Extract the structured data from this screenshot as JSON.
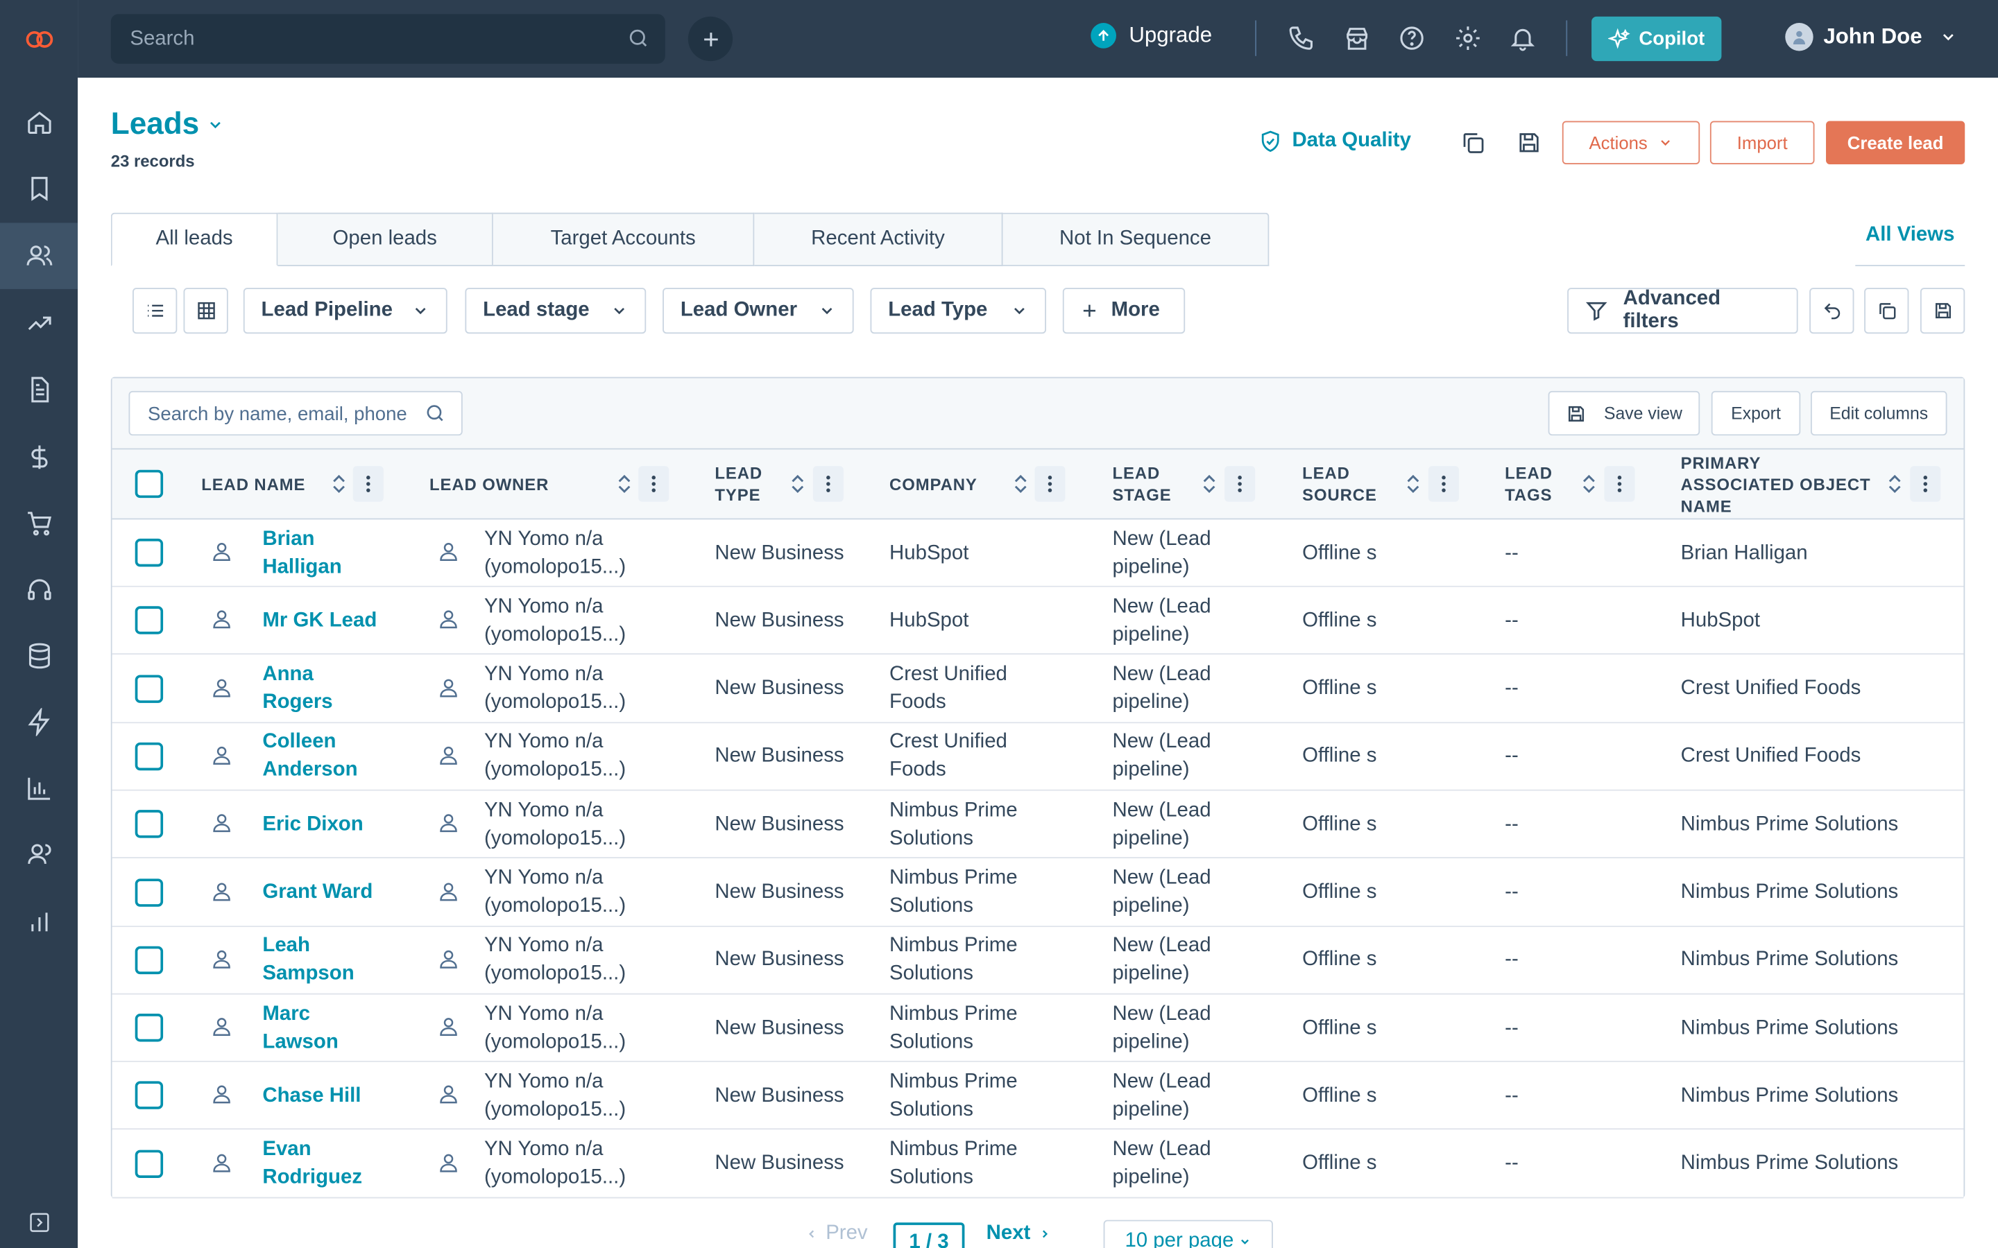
{
  "topbar": {
    "search_placeholder": "Search",
    "upgrade_label": "Upgrade",
    "copilot_label": "Copilot",
    "user_name": "John Doe"
  },
  "sidebar": {
    "items": [
      {
        "icon": "home-icon"
      },
      {
        "icon": "bookmark-icon"
      },
      {
        "icon": "contacts-icon",
        "active": true
      },
      {
        "icon": "trend-icon"
      },
      {
        "icon": "document-icon"
      },
      {
        "icon": "dollar-icon"
      },
      {
        "icon": "cart-icon"
      },
      {
        "icon": "headset-icon"
      },
      {
        "icon": "database-icon"
      },
      {
        "icon": "lightning-icon"
      },
      {
        "icon": "bar-chart-icon"
      },
      {
        "icon": "people-icon"
      },
      {
        "icon": "analytics-icon"
      }
    ]
  },
  "header": {
    "title": "Leads",
    "records": "23 records",
    "data_quality": "Data Quality",
    "actions_label": "Actions",
    "import_label": "Import",
    "create_label": "Create lead"
  },
  "tabs": [
    "All leads",
    "Open leads",
    "Target Accounts",
    "Recent Activity",
    "Not In Sequence"
  ],
  "all_views": "All Views",
  "filters": {
    "lead_pipeline": "Lead Pipeline",
    "lead_stage": "Lead stage",
    "lead_owner": "Lead Owner",
    "lead_type": "Lead Type",
    "more": "More",
    "advanced": "Advanced filters"
  },
  "table_bar": {
    "search_placeholder": "Search by name, email, phone",
    "save_view": "Save view",
    "export": "Export",
    "edit_columns": "Edit columns"
  },
  "columns": {
    "lead_name": "LEAD NAME",
    "lead_owner": "LEAD OWNER",
    "lead_type_1": "LEAD",
    "lead_type_2": "TYPE",
    "company": "COMPANY",
    "lead_stage_1": "LEAD",
    "lead_stage_2": "STAGE",
    "lead_source_1": "LEAD",
    "lead_source_2": "SOURCE",
    "lead_tags_1": "LEAD",
    "lead_tags_2": "TAGS",
    "primary_1": "PRIMARY",
    "primary_2": "ASSOCIATED OBJECT",
    "primary_3": "NAME"
  },
  "rows": [
    {
      "name1": "Brian",
      "name2": "Halligan",
      "owner1": "YN Yomo n/a",
      "owner2": "(yomolopo15...)",
      "type": "New Business",
      "company1": "HubSpot",
      "company2": "",
      "stage1": "New (Lead",
      "stage2": "pipeline)",
      "source": "Offline s",
      "tags": "--",
      "primary": "Brian Halligan"
    },
    {
      "name1": "Mr GK Lead",
      "name2": "",
      "owner1": "YN Yomo n/a",
      "owner2": "(yomolopo15...)",
      "type": "New Business",
      "company1": "HubSpot",
      "company2": "",
      "stage1": "New (Lead",
      "stage2": "pipeline)",
      "source": "Offline s",
      "tags": "--",
      "primary": "HubSpot"
    },
    {
      "name1": "Anna",
      "name2": "Rogers",
      "owner1": "YN Yomo n/a",
      "owner2": "(yomolopo15...)",
      "type": "New Business",
      "company1": "Crest Unified",
      "company2": "Foods",
      "stage1": "New (Lead",
      "stage2": "pipeline)",
      "source": "Offline s",
      "tags": "--",
      "primary": "Crest Unified Foods"
    },
    {
      "name1": "Colleen",
      "name2": "Anderson",
      "owner1": "YN Yomo n/a",
      "owner2": "(yomolopo15...)",
      "type": "New Business",
      "company1": "Crest Unified",
      "company2": "Foods",
      "stage1": "New (Lead",
      "stage2": "pipeline)",
      "source": "Offline s",
      "tags": "--",
      "primary": "Crest Unified Foods"
    },
    {
      "name1": "Eric Dixon",
      "name2": "",
      "owner1": "YN Yomo n/a",
      "owner2": "(yomolopo15...)",
      "type": "New Business",
      "company1": "Nimbus Prime",
      "company2": "Solutions",
      "stage1": "New (Lead",
      "stage2": "pipeline)",
      "source": "Offline s",
      "tags": "--",
      "primary": "Nimbus Prime Solutions"
    },
    {
      "name1": "Grant Ward",
      "name2": "",
      "owner1": "YN Yomo n/a",
      "owner2": "(yomolopo15...)",
      "type": "New Business",
      "company1": "Nimbus Prime",
      "company2": "Solutions",
      "stage1": "New (Lead",
      "stage2": "pipeline)",
      "source": "Offline s",
      "tags": "--",
      "primary": "Nimbus Prime Solutions"
    },
    {
      "name1": "Leah",
      "name2": "Sampson",
      "owner1": "YN Yomo n/a",
      "owner2": "(yomolopo15...)",
      "type": "New Business",
      "company1": "Nimbus Prime",
      "company2": "Solutions",
      "stage1": "New (Lead",
      "stage2": "pipeline)",
      "source": "Offline s",
      "tags": "--",
      "primary": "Nimbus Prime Solutions"
    },
    {
      "name1": "Marc",
      "name2": "Lawson",
      "owner1": "YN Yomo n/a",
      "owner2": "(yomolopo15...)",
      "type": "New Business",
      "company1": "Nimbus Prime",
      "company2": "Solutions",
      "stage1": "New (Lead",
      "stage2": "pipeline)",
      "source": "Offline s",
      "tags": "--",
      "primary": "Nimbus Prime Solutions"
    },
    {
      "name1": "Chase Hill",
      "name2": "",
      "owner1": "YN Yomo n/a",
      "owner2": "(yomolopo15...)",
      "type": "New Business",
      "company1": "Nimbus Prime",
      "company2": "Solutions",
      "stage1": "New (Lead",
      "stage2": "pipeline)",
      "source": "Offline s",
      "tags": "--",
      "primary": "Nimbus Prime Solutions"
    },
    {
      "name1": "Evan",
      "name2": "Rodriguez",
      "owner1": "YN Yomo n/a",
      "owner2": "(yomolopo15...)",
      "type": "New Business",
      "company1": "Nimbus Prime",
      "company2": "Solutions",
      "stage1": "New (Lead",
      "stage2": "pipeline)",
      "source": "Offline s",
      "tags": "--",
      "primary": "Nimbus Prime Solutions"
    }
  ],
  "pagination": {
    "prev": "Prev",
    "current": "1 / 3",
    "next": "Next",
    "per_page": "10 per page"
  },
  "colors": {
    "nav_bg": "#2d3e50",
    "accent_teal": "#0091ae",
    "orange": "#e47656",
    "copilot": "#2fa7b7"
  }
}
